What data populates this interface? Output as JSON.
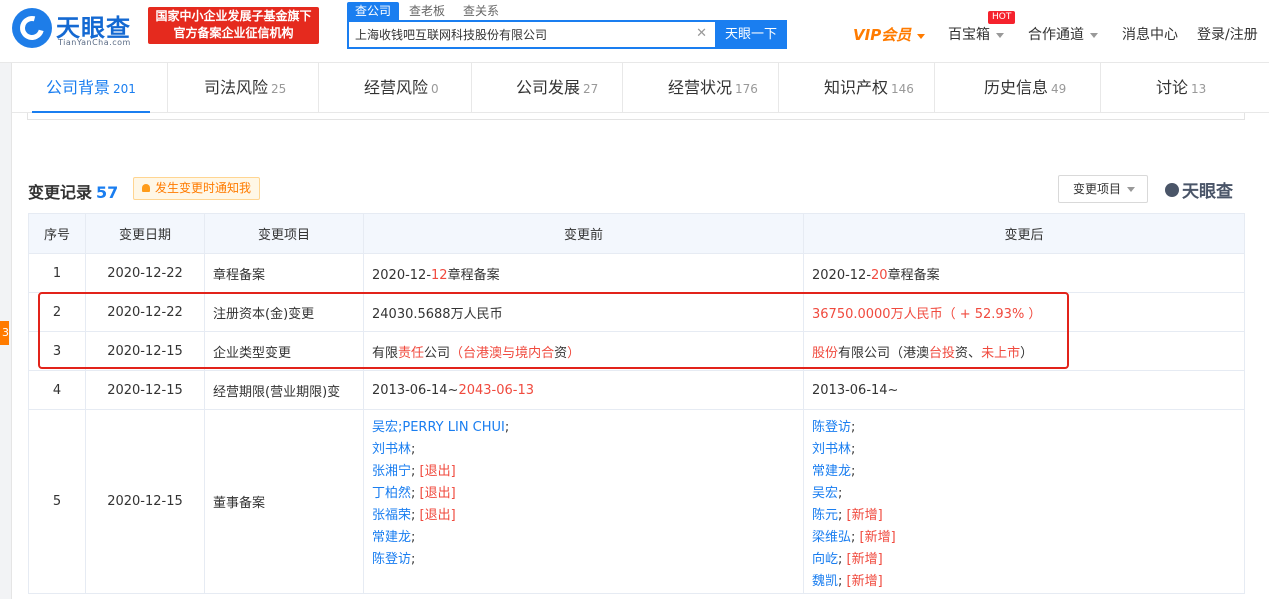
{
  "header": {
    "logo_cn": "天眼查",
    "logo_en": "TianYanCha.com",
    "badge_line1": "国家中小企业发展子基金旗下",
    "badge_line2": "官方备案企业征信机构",
    "search_tabs": [
      "查公司",
      "查老板",
      "查关系"
    ],
    "search_value": "上海收钱吧互联网科技股份有限公司",
    "search_button": "天眼一下",
    "vip": "VIP会员",
    "treasure": "百宝箱",
    "hot": "HOT",
    "cooperation": "合作通道",
    "messages": "消息中心",
    "login": "登录/注册"
  },
  "left_strip": {
    "number": "3"
  },
  "tabs": [
    {
      "label": "公司背景",
      "count": "201"
    },
    {
      "label": "司法风险",
      "count": "25"
    },
    {
      "label": "经营风险",
      "count": "0"
    },
    {
      "label": "公司发展",
      "count": "27"
    },
    {
      "label": "经营状况",
      "count": "176"
    },
    {
      "label": "知识产权",
      "count": "146"
    },
    {
      "label": "历史信息",
      "count": "49"
    },
    {
      "label": "讨论",
      "count": "13"
    }
  ],
  "section": {
    "title": "变更记录",
    "count": "57",
    "notify": "发生变更时通知我",
    "filter": "变更项目",
    "brand": "天眼查"
  },
  "table": {
    "headers": [
      "序号",
      "变更日期",
      "变更项目",
      "变更前",
      "变更后"
    ],
    "rows": [
      {
        "no": "1",
        "date": "2020-12-22",
        "item": "章程备案",
        "before": [
          [
            "2020-12-",
            ""
          ],
          [
            "12",
            "red"
          ],
          [
            "章程备案",
            ""
          ]
        ],
        "after": [
          [
            "2020-12-",
            ""
          ],
          [
            "20",
            "red"
          ],
          [
            "章程备案",
            ""
          ]
        ]
      },
      {
        "no": "2",
        "date": "2020-12-22",
        "item": "注册资本(金)变更",
        "before": [
          [
            "24030.5688万人民币",
            ""
          ]
        ],
        "after": [
          [
            "36750.0000万人民币（ + 52.93% ）",
            "red"
          ]
        ]
      },
      {
        "no": "3",
        "date": "2020-12-15",
        "item": "企业类型变更",
        "before": [
          [
            "有限",
            ""
          ],
          [
            "责任",
            "red"
          ],
          [
            "公司",
            ""
          ],
          [
            "（台港澳",
            "red"
          ],
          [
            "与境内合",
            "red"
          ],
          [
            "资",
            ""
          ],
          [
            "）",
            "red"
          ]
        ],
        "after": [
          [
            "股份",
            "red"
          ],
          [
            "有限公司（港澳",
            ""
          ],
          [
            "台投",
            "red"
          ],
          [
            "资、",
            ""
          ],
          [
            "未上市",
            "red"
          ],
          [
            "）",
            ""
          ]
        ]
      },
      {
        "no": "4",
        "date": "2020-12-15",
        "item": "经营期限(营业期限)变",
        "before": [
          [
            "2013-06-14~",
            ""
          ],
          [
            "2043-06-13",
            "red"
          ]
        ],
        "after": [
          [
            "2013-06-14~",
            ""
          ]
        ]
      }
    ],
    "directors_row": {
      "no": "5",
      "date": "2020-12-15",
      "item": "董事备案",
      "before": [
        {
          "name": "吴宏;PERRY LIN CHUI",
          "tag": ""
        },
        {
          "name": "刘书林",
          "tag": ""
        },
        {
          "name": "张湘宁",
          "tag": "[退出]"
        },
        {
          "name": "丁柏然",
          "tag": "[退出]"
        },
        {
          "name": "张福荣",
          "tag": "[退出]"
        },
        {
          "name": "常建龙",
          "tag": ""
        },
        {
          "name": "陈登访",
          "tag": ""
        }
      ],
      "after": [
        {
          "name": "陈登访",
          "tag": ""
        },
        {
          "name": "刘书林",
          "tag": ""
        },
        {
          "name": "常建龙",
          "tag": ""
        },
        {
          "name": "吴宏",
          "tag": ""
        },
        {
          "name": "陈元",
          "tag": "[新增]"
        },
        {
          "name": "梁维弘",
          "tag": "[新增]"
        },
        {
          "name": "向屹",
          "tag": "[新增]"
        },
        {
          "name": "魏凯",
          "tag": "[新增]"
        }
      ]
    }
  },
  "colors": {
    "accent": "#1a7ef0",
    "highlight": "#e2231a",
    "change": "#f04a3e",
    "vip": "#ff7b00"
  }
}
